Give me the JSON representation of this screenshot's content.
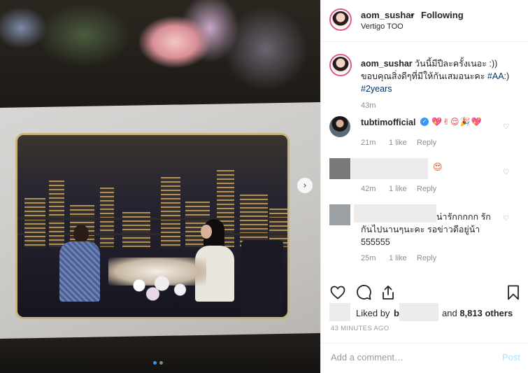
{
  "post": {
    "username": "aom_sushar",
    "separator": "•",
    "follow_state": "Following",
    "location": "Vertigo TOO"
  },
  "caption": {
    "username": "aom_sushar",
    "text_1": " วันนี้มีปีละครั้งเนอะ :))",
    "text_2": "ขอบคุณสิ่งดีๆที่มีให้กันเสมอนะคะ ",
    "hashtag_1": "#AA",
    "text_3": ":)",
    "hashtag_2": "#2years",
    "time": "43m"
  },
  "comments": [
    {
      "username": "tubtimofficial",
      "verified_icon": "check-icon",
      "text": "💖✌😌🎉💖",
      "time": "21m",
      "likes": "1 like",
      "reply": "Reply"
    },
    {
      "username": "",
      "text": "😍",
      "time": "42m",
      "likes": "1 like",
      "reply": "Reply"
    },
    {
      "username": "",
      "text_line_1": "น่ารักกกกก รัก",
      "text_line_2": "กันไปนานๆนะคะ รอข่าวดีอยู่น้า",
      "text_line_3": "555555",
      "time": "25m",
      "likes": "1 like",
      "reply": "Reply"
    }
  ],
  "likes": {
    "liked_by": "Liked by",
    "user_fragment": "b",
    "and_text": "and",
    "others": "8,813 others"
  },
  "posted_ago": "43 MINUTES AGO",
  "add_comment": {
    "placeholder": "Add a comment…",
    "post_label": "Post"
  },
  "carousel": {
    "index": 1,
    "count": 2
  },
  "colors": {
    "accent": "#3897f0",
    "hashtag": "#003569",
    "story_ring": "#e15b86",
    "post_disabled": "#b2dffc"
  }
}
